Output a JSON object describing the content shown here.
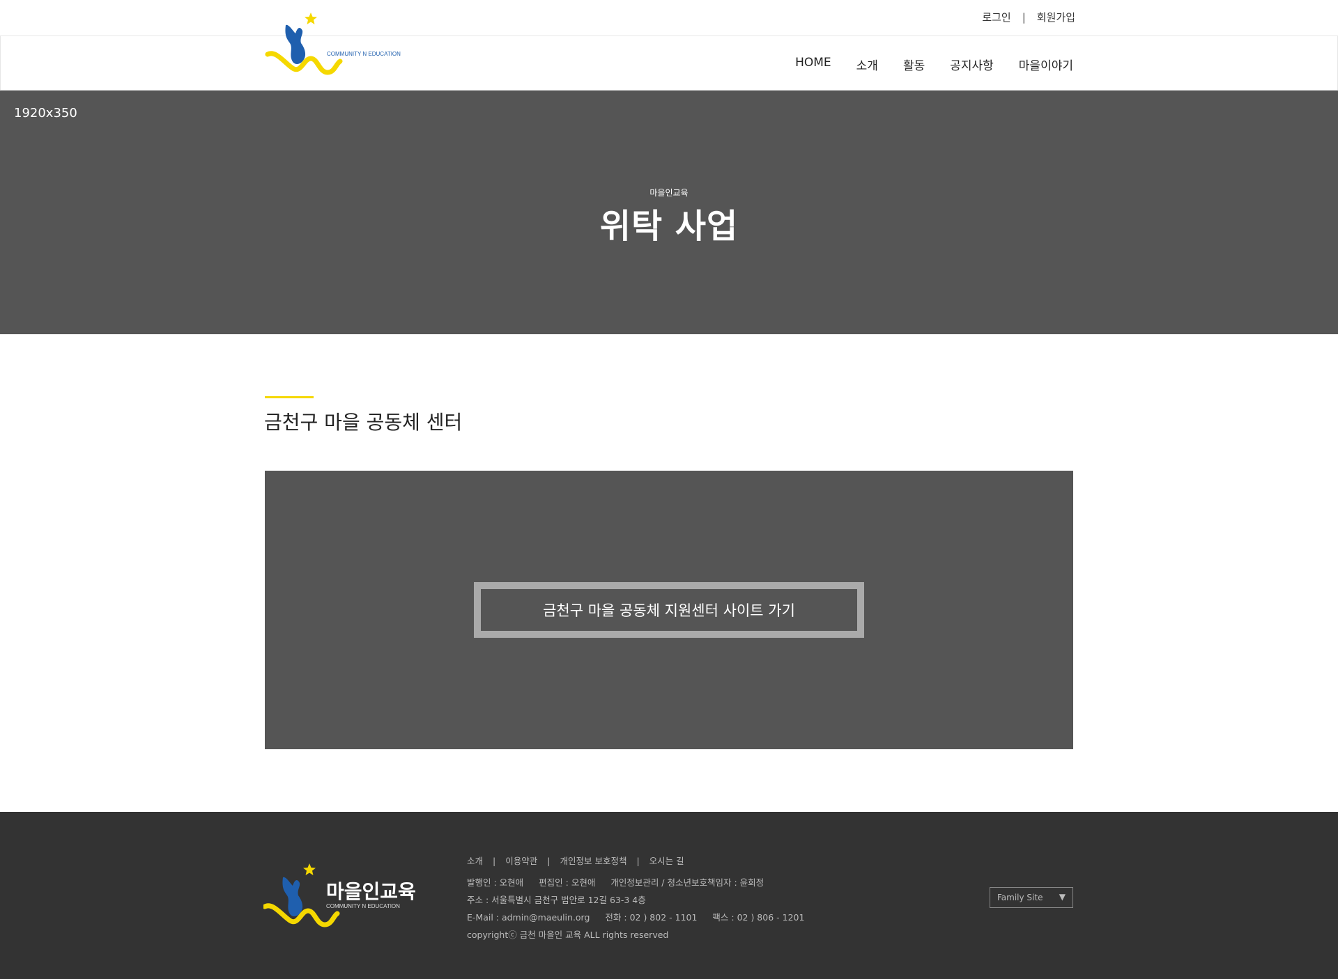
{
  "util": {
    "login": "로그인",
    "separator": "|",
    "signup": "회원가입"
  },
  "brand": {
    "logo_name": "마을인교육",
    "logo_sub": "COMMUNITY N EDUCATION"
  },
  "nav": {
    "items": [
      "HOME",
      "소개",
      "활동",
      "공지사항",
      "마을이야기"
    ]
  },
  "hero": {
    "size_label": "1920x350",
    "subtitle": "마을인교육",
    "title": "위탁 사업"
  },
  "section": {
    "title": "금천구 마을 공동체 센터",
    "link_button": "금천구 마을 공동체 지원센터 사이트 가기"
  },
  "footer": {
    "links": [
      "소개",
      "이용약관",
      "개인정보 보호정책",
      "오시는 길"
    ],
    "separator": "|",
    "publisher": "발행인 : 오현애",
    "editor": "편집인 : 오현애",
    "privacy_officer": "개인정보관리 / 청소년보호책임자 : 윤희정",
    "address": "주소 : 서울특별시 금천구 범안로 12길 63-3 4층",
    "email": "E-Mail : admin@maeulin.org",
    "phone": "전화 : 02 ) 802 - 1101",
    "fax": "팩스 : 02 ) 806 - 1201",
    "copyright": "copyrightⓒ 금천 마을인 교육 ALL rights reserved",
    "family_site": "Family Site"
  },
  "colors": {
    "accent": "#f5d800",
    "logo_blue": "#1f5fae",
    "hero_bg": "#555555",
    "footer_bg": "#333333"
  }
}
